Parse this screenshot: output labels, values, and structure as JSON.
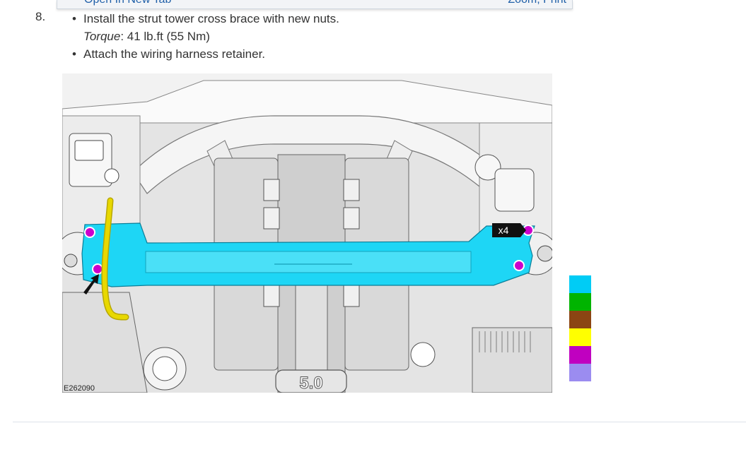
{
  "toolbar": {
    "open_new_tab": "Open In New Tab",
    "zoom_print": "Zoom, Print"
  },
  "step": {
    "number": "8.",
    "bullet_1": "Install the strut tower cross brace with new nuts.",
    "torque_label": "Torque",
    "torque_value": ": 41 lb.ft (55 Nm)",
    "bullet_2": "Attach the wiring harness retainer."
  },
  "figure": {
    "callout": "x4",
    "figure_id": "E262090",
    "engine_badge": "5.0"
  },
  "legend": {
    "colors": [
      "#00ccf5",
      "#00b400",
      "#8b4513",
      "#ffff00",
      "#c000c0",
      "#9b8cf0"
    ]
  },
  "colors": {
    "brace": "#1ed6f5",
    "fastener": "#cc00cc",
    "harness": "#e8d800",
    "link": "#1f5fa8"
  }
}
